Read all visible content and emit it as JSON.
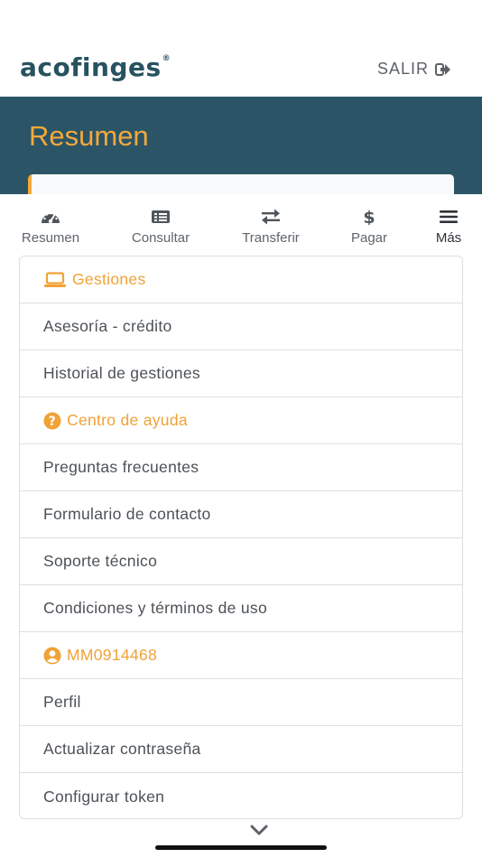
{
  "header": {
    "logo_text": "acofinges",
    "logo_mark": "®",
    "logout_label": "SALIR",
    "logout_icon": "sign-out-icon"
  },
  "banner": {
    "title": "Resumen"
  },
  "tabs": [
    {
      "label": "Resumen",
      "icon": "gauge-icon"
    },
    {
      "label": "Consultar",
      "icon": "list-icon"
    },
    {
      "label": "Transferir",
      "icon": "exchange-icon"
    },
    {
      "label": "Pagar",
      "icon": "dollar-icon"
    },
    {
      "label": "Más",
      "icon": "menu-icon",
      "active": true
    }
  ],
  "menu": {
    "sections": [
      {
        "title": "Gestiones",
        "icon": "laptop-icon",
        "items": [
          "Asesoría - crédito",
          "Historial de gestiones"
        ]
      },
      {
        "title": "Centro de ayuda",
        "icon": "question-circle-icon",
        "items": [
          "Preguntas frecuentes",
          "Formulario de contacto",
          "Soporte técnico",
          "Condiciones y términos de uso"
        ]
      },
      {
        "title": "MM0914468",
        "icon": "user-circle-icon",
        "items": [
          "Perfil",
          "Actualizar contraseña",
          "Configurar token"
        ]
      }
    ]
  },
  "colors": {
    "accent": "#f4a93a",
    "brand": "#27525f",
    "banner": "#2b5566"
  }
}
